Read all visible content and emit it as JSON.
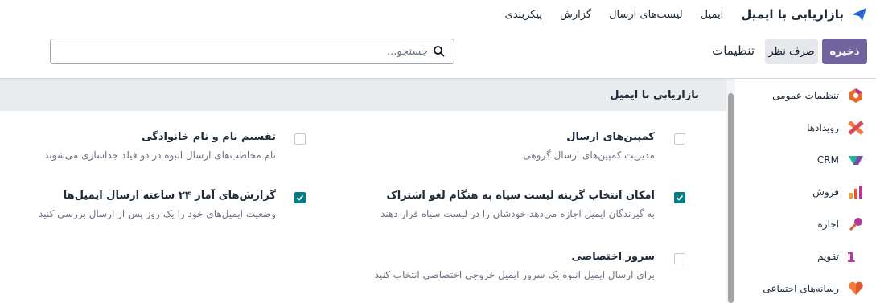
{
  "nav": {
    "app_title": "بازاریابی با ایمیل",
    "items": [
      "ایمیل",
      "لیست‌های ارسال",
      "گزارش",
      "پیکربندی"
    ]
  },
  "control": {
    "save_label": "ذخیره",
    "discard_label": "صرف نظر",
    "breadcrumb": "تنظیمات",
    "search_placeholder": "جستجو..."
  },
  "sidebar": {
    "items": [
      {
        "label": "تنظیمات عمومی",
        "icon": "general-settings-icon"
      },
      {
        "label": "رویدادها",
        "icon": "events-icon"
      },
      {
        "label": "CRM",
        "icon": "crm-icon"
      },
      {
        "label": "فروش",
        "icon": "sales-icon"
      },
      {
        "label": "اجاره",
        "icon": "rental-icon"
      },
      {
        "label": "تقویم",
        "icon": "calendar-icon"
      },
      {
        "label": "رسانه‌های اجتماعی",
        "icon": "social-media-icon"
      }
    ]
  },
  "section": {
    "title": "بازاریابی با ایمیل",
    "settings": [
      {
        "title": "کمپین‌های ارسال",
        "desc": "مدیریت کمپین‌های ارسال گروهی",
        "checked": false
      },
      {
        "title": "تقسیم نام و نام خانوادگی",
        "desc": "نام مخاطب‌های ارسال انبوه در دو فیلد جداسازی می‌شوند",
        "checked": false
      },
      {
        "title": "امکان انتخاب گزینه لیست سیاه به هنگام لغو اشتراک",
        "desc": "به گیرندگان ایمیل اجازه می‌دهد خودشان را در لیست سیاه قرار دهند",
        "checked": true
      },
      {
        "title": "گزارش‌های آمار ۲۴ ساعته ارسال ایمیل‌ها",
        "desc": "وضعیت ایمیل‌های خود را یک روز پس از ارسال بررسی کنید",
        "checked": true
      },
      {
        "title": "سرور اختصاصی",
        "desc": "برای ارسال ایمیل انبوه یک سرور ایمیل خروجی اختصاصی انتخاب کنید",
        "checked": false
      }
    ]
  },
  "colors": {
    "brand": "#71639e",
    "checkbox_checked": "#017e84"
  }
}
